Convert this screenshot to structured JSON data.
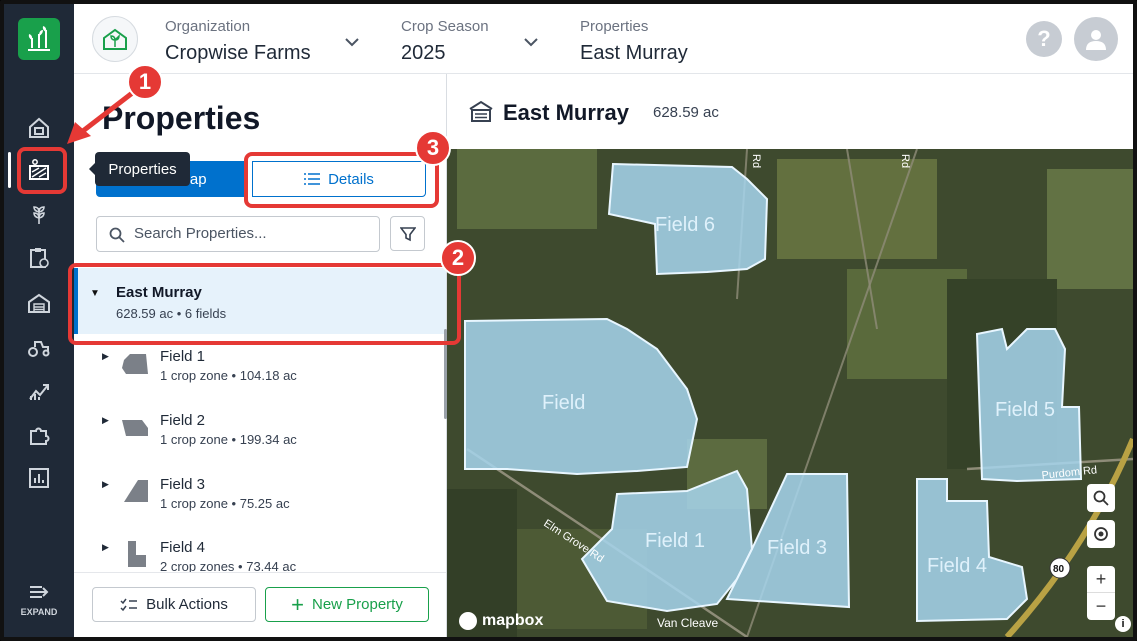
{
  "sidebar": {
    "expand_label": "EXPAND",
    "tooltip": "Properties"
  },
  "header": {
    "org_label": "Organization",
    "org_value": "Cropwise Farms",
    "season_label": "Crop Season",
    "season_value": "2025",
    "prop_label": "Properties",
    "prop_value": "East Murray",
    "help": "?"
  },
  "panel": {
    "title": "Properties",
    "map_tab": "Map",
    "details_tab": "Details",
    "search_placeholder": "Search Properties...",
    "property": {
      "name": "East Murray",
      "sub": "628.59 ac • 6 fields"
    },
    "fields": [
      {
        "name": "Field 1",
        "sub": "1 crop zone • 104.18 ac"
      },
      {
        "name": "Field 2",
        "sub": "1 crop zone • 199.34 ac"
      },
      {
        "name": "Field 3",
        "sub": "1 crop zone • 75.25 ac"
      },
      {
        "name": "Field 4",
        "sub": "2 crop zones • 73.44 ac"
      }
    ],
    "bulk_label": "Bulk Actions",
    "new_label": "New Property"
  },
  "map": {
    "title": "East Murray",
    "area": "628.59 ac",
    "fields": [
      "Field 6",
      "Field 5",
      "Field 1",
      "Field 3",
      "Field 4",
      "Field"
    ],
    "roads": [
      "Elm Grove Rd",
      "Van Cleave",
      "Purdom Rd",
      "Rd",
      "Rd"
    ],
    "highway": "80",
    "attribution": "mapbox",
    "info": "i",
    "zoom_in": "+",
    "zoom_out": "−"
  },
  "annotations": [
    "1",
    "2",
    "3"
  ],
  "colors": {
    "accent": "#0071cd",
    "green": "#19a04b",
    "red": "#e53935",
    "field_fill": "#a7d6ee"
  }
}
